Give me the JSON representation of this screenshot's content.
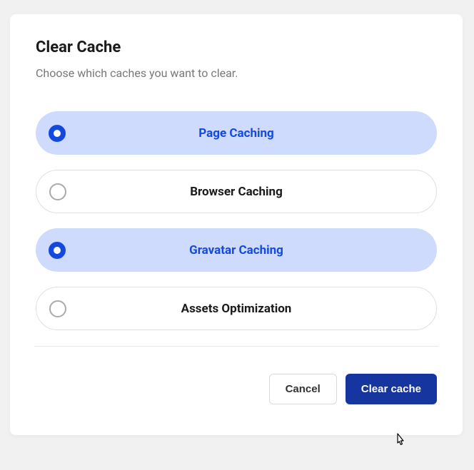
{
  "modal": {
    "title": "Clear Cache",
    "subtitle": "Choose which caches you want to clear.",
    "options": [
      {
        "label": "Page Caching",
        "selected": true
      },
      {
        "label": "Browser Caching",
        "selected": false
      },
      {
        "label": "Gravatar Caching",
        "selected": true
      },
      {
        "label": "Assets Optimization",
        "selected": false
      }
    ],
    "buttons": {
      "cancel": "Cancel",
      "confirm": "Clear cache"
    }
  }
}
